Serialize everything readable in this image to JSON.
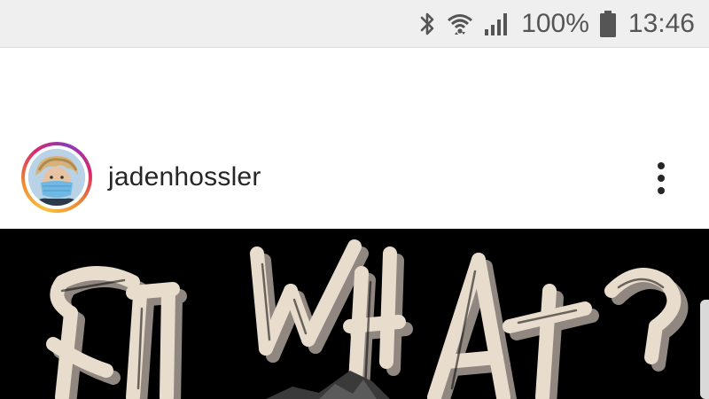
{
  "status_bar": {
    "battery_percent": "100%",
    "time": "13:46",
    "icons": [
      "bluetooth-icon",
      "wifi-icon",
      "signal-icon",
      "battery-icon"
    ]
  },
  "post": {
    "username": "jadenhossler",
    "avatar_icon": "profile-photo",
    "more_icon": "more-vertical-icon",
    "image_text": "SO WHAT?",
    "colors": {
      "image_bg": "#000000",
      "lettering": "#e8dccd",
      "lettering_shadow": "#9a9189"
    }
  }
}
